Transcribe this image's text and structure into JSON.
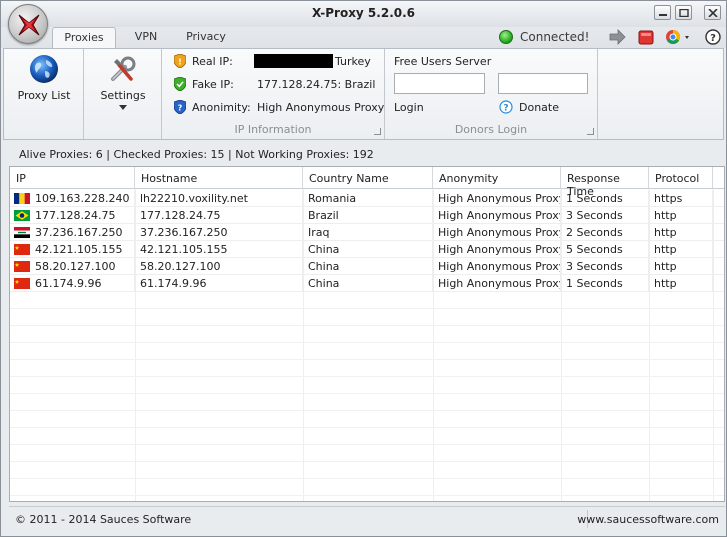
{
  "window": {
    "title": "X-Proxy 5.2.0.6"
  },
  "tabs": [
    {
      "label": "Proxies",
      "active": true
    },
    {
      "label": "VPN",
      "active": false
    },
    {
      "label": "Privacy",
      "active": false
    }
  ],
  "status": {
    "text": "Connected!",
    "color": "#2fbf2a"
  },
  "toolbar_icons": [
    "forward-arrow-icon",
    "stop-icon",
    "chrome-browser-icon",
    "help-icon"
  ],
  "ribbon": {
    "proxy_list_label": "Proxy List",
    "settings_label": "Settings",
    "ip_info": {
      "caption": "IP Information",
      "real_ip_label": "Real IP:",
      "real_ip_country": "Turkey",
      "fake_ip_label": "Fake IP:",
      "fake_ip_value": "177.128.24.75: Brazil",
      "anonymity_label": "Anonimity:",
      "anonymity_value": "High Anonymous Proxy"
    },
    "donors": {
      "caption": "Donors Login",
      "free_server_label": "Free Users Server",
      "login_label": "Login",
      "donate_label": "Donate"
    }
  },
  "counts_text": "Alive Proxies: 6 | Checked Proxies: 15 | Not Working Proxies: 192",
  "table": {
    "columns": [
      "IP",
      "Hostname",
      "Country Name",
      "Anonymity",
      "Response Time",
      "Protocol"
    ],
    "rows": [
      {
        "flag": "romania",
        "ip": "109.163.228.240",
        "hostname": "lh22210.voxility.net",
        "country": "Romania",
        "anonymity": "High Anonymous Proxy",
        "response": "1 Seconds",
        "protocol": "https"
      },
      {
        "flag": "brazil",
        "ip": "177.128.24.75",
        "hostname": "177.128.24.75",
        "country": "Brazil",
        "anonymity": "High Anonymous Proxy",
        "response": "3 Seconds",
        "protocol": "http"
      },
      {
        "flag": "iraq",
        "ip": "37.236.167.250",
        "hostname": "37.236.167.250",
        "country": "Iraq",
        "anonymity": "High Anonymous Proxy",
        "response": "2 Seconds",
        "protocol": "http"
      },
      {
        "flag": "china",
        "ip": "42.121.105.155",
        "hostname": "42.121.105.155",
        "country": "China",
        "anonymity": "High Anonymous Proxy",
        "response": "5 Seconds",
        "protocol": "http"
      },
      {
        "flag": "china",
        "ip": "58.20.127.100",
        "hostname": "58.20.127.100",
        "country": "China",
        "anonymity": "High Anonymous Proxy",
        "response": "3 Seconds",
        "protocol": "http"
      },
      {
        "flag": "china",
        "ip": "61.174.9.96",
        "hostname": "61.174.9.96",
        "country": "China",
        "anonymity": "High Anonymous Proxy",
        "response": "1 Seconds",
        "protocol": "http"
      }
    ]
  },
  "footer": {
    "copyright": "© 2011 - 2014 Sauces Software",
    "website": "www.saucessoftware.com"
  }
}
